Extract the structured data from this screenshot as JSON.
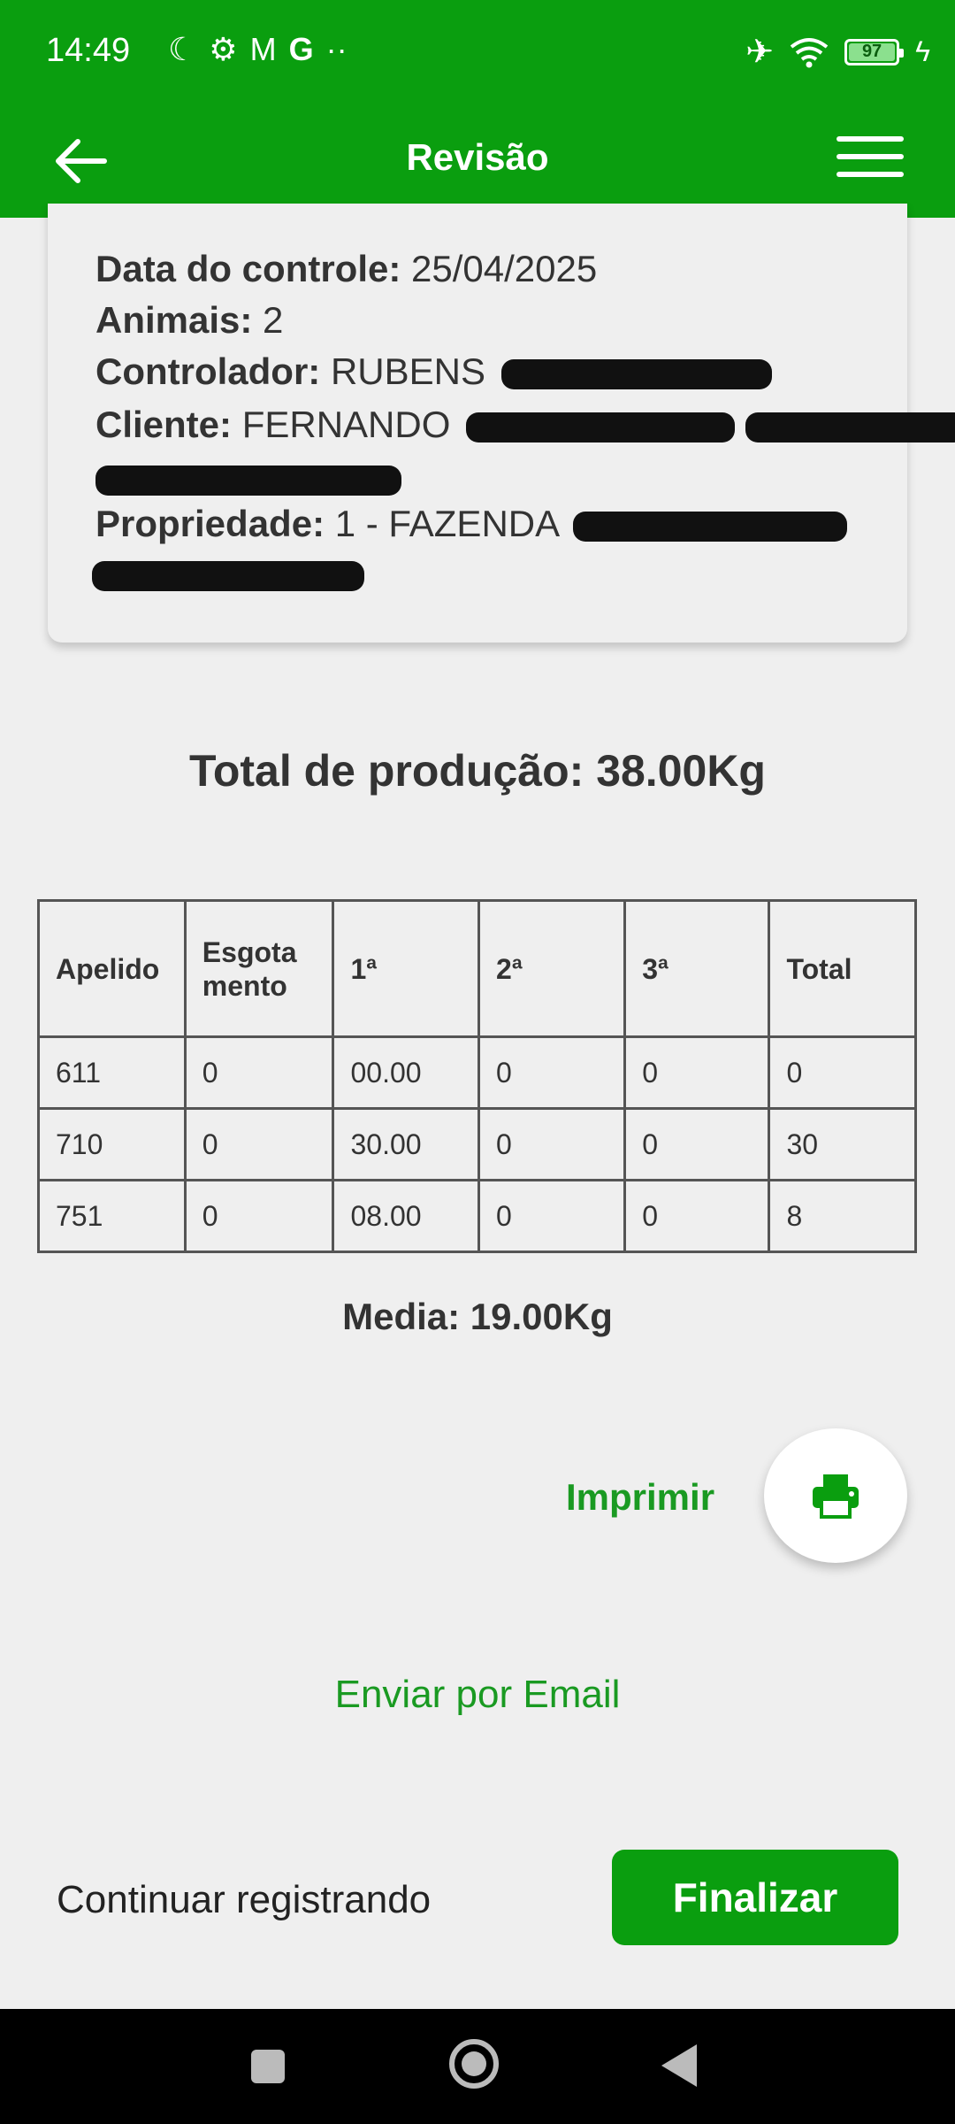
{
  "status_bar": {
    "time": "14:49",
    "battery": "97",
    "left_icons": [
      "moon-icon",
      "gear-icon",
      "gmail-icon",
      "google-icon",
      "more-dots-icon"
    ],
    "right_icons": [
      "airplane-icon",
      "wifi-icon",
      "battery-icon",
      "charging-icon"
    ]
  },
  "app_bar": {
    "title": "Revisão"
  },
  "card": {
    "data_label": "Data do controle:",
    "data_value": "25/04/2025",
    "animais_label": "Animais:",
    "animais_value": "2",
    "controlador_label": "Controlador:",
    "controlador_value": "RUBENS",
    "cliente_label": "Cliente:",
    "cliente_value": "FERNANDO",
    "propriedade_label": "Propriedade:",
    "propriedade_value": "1 - FAZENDA"
  },
  "total_label": "Total de produção: 38.00Kg",
  "table": {
    "headers": [
      "Apelido",
      "Esgota mento",
      "1ª",
      "2ª",
      "3ª",
      "Total"
    ],
    "rows": [
      [
        "611",
        "0",
        "00.00",
        "0",
        "0",
        "0"
      ],
      [
        "710",
        "0",
        "30.00",
        "0",
        "0",
        "30"
      ],
      [
        "751",
        "0",
        "08.00",
        "0",
        "0",
        "8"
      ]
    ]
  },
  "media_label": "Media: 19.00Kg",
  "print_label": "Imprimir",
  "email_label": "Enviar por Email",
  "continue_label": "Continuar registrando",
  "finalize_label": "Finalizar",
  "colors": {
    "primary": "#0a9e0f",
    "accent_text": "#1a9a22",
    "background": "#efefef"
  }
}
